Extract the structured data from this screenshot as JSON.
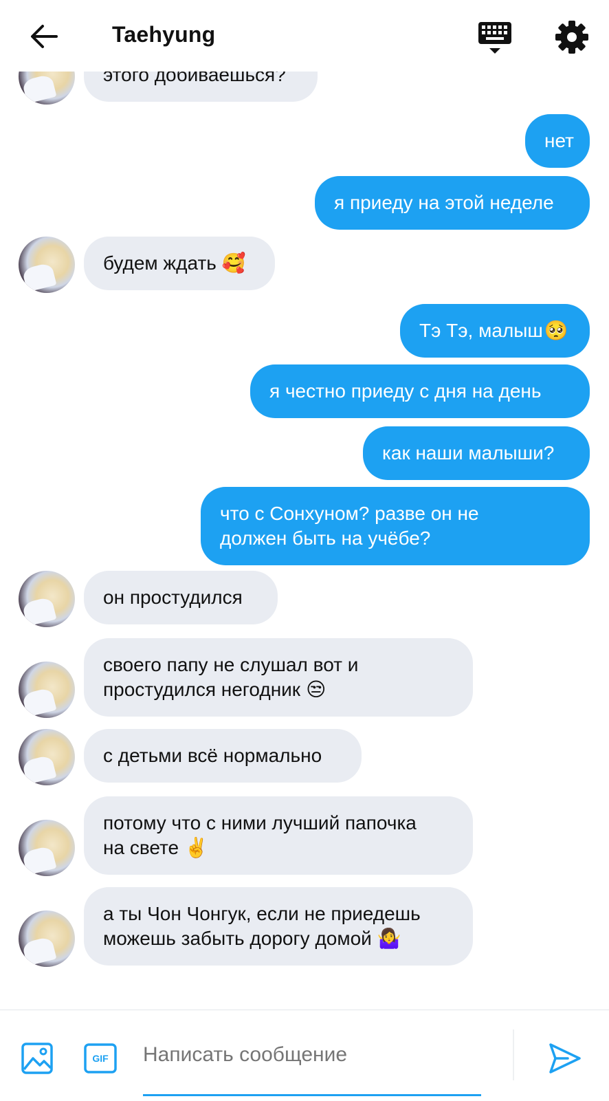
{
  "header": {
    "title": "Taehyung",
    "back_icon": "arrow-left-icon",
    "keyboard_icon": "keyboard-icon",
    "settings_icon": "gear-icon"
  },
  "colors": {
    "outgoing": "#1da1f2",
    "incoming": "#e9ecf2",
    "accent": "#1da1f2"
  },
  "messages": [
    {
      "dir": "in",
      "text": "этого добиваешься?"
    },
    {
      "dir": "out",
      "text": "нет"
    },
    {
      "dir": "out",
      "text": "я приеду на этой неделе"
    },
    {
      "dir": "in",
      "text": "будем ждать",
      "emoji": "🥰"
    },
    {
      "dir": "out",
      "text": "Тэ Тэ, малыш",
      "emoji": "🥺"
    },
    {
      "dir": "out",
      "text": "я честно приеду с дня на день"
    },
    {
      "dir": "out",
      "text": "как наши малыши?"
    },
    {
      "dir": "out",
      "line1": "что с Сонхуном? разве он не",
      "line2": "должен быть на учёбе?"
    },
    {
      "dir": "in",
      "text": "он простудился"
    },
    {
      "dir": "in",
      "line1": "своего папу не слушал вот и",
      "line2": "простудился негодник",
      "emoji": "😒"
    },
    {
      "dir": "in",
      "text": "с детьми всё нормально"
    },
    {
      "dir": "in",
      "line1": "потому что с ними лучший папочка",
      "line2": "на свете",
      "emoji": "✌️"
    },
    {
      "dir": "in",
      "line1": "а ты Чон Чонгук, если не приедешь",
      "line2": "можешь забыть дорогу домой",
      "emoji": "🤷‍♀️"
    }
  ],
  "composer": {
    "placeholder": "Написать сообщение",
    "image_icon": "image-icon",
    "gif_label": "GIF",
    "send_icon": "send-icon"
  }
}
